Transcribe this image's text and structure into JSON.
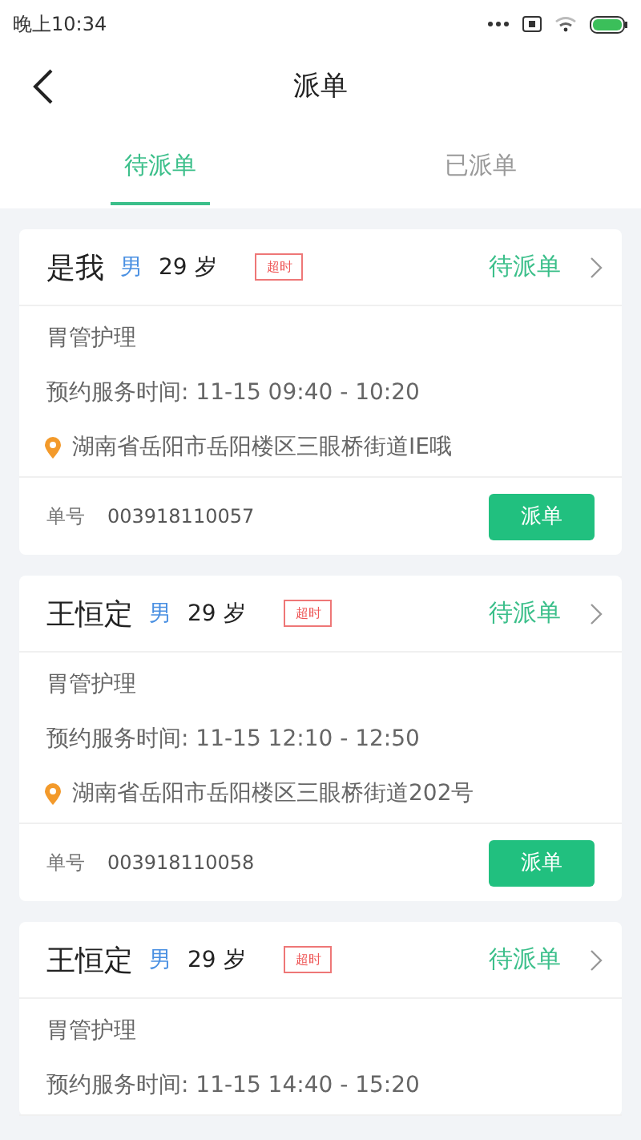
{
  "status_bar": {
    "time": "晚上10:34"
  },
  "header": {
    "title": "派单"
  },
  "tabs": [
    {
      "label": "待派单",
      "selected": true
    },
    {
      "label": "已派单",
      "selected": false
    }
  ],
  "orders": [
    {
      "name": "是我",
      "gender": "男",
      "age": "29 岁",
      "badge": "超时",
      "status": "待派单",
      "service": "胃管护理",
      "time": "预约服务时间: 11-15  09:40 - 10:20",
      "address": "湖南省岳阳市岳阳楼区三眼桥街道IE哦",
      "order_label": "单号",
      "order_no": "003918110057",
      "action": "派单"
    },
    {
      "name": "王恒定",
      "gender": "男",
      "age": "29 岁",
      "badge": "超时",
      "status": "待派单",
      "service": "胃管护理",
      "time": "预约服务时间: 11-15  12:10 - 12:50",
      "address": "湖南省岳阳市岳阳楼区三眼桥街道202号",
      "order_label": "单号",
      "order_no": "003918110058",
      "action": "派单"
    },
    {
      "name": "王恒定",
      "gender": "男",
      "age": "29 岁",
      "badge": "超时",
      "status": "待派单",
      "service": "胃管护理",
      "time": "预约服务时间: 11-15  14:40 - 15:20"
    }
  ]
}
